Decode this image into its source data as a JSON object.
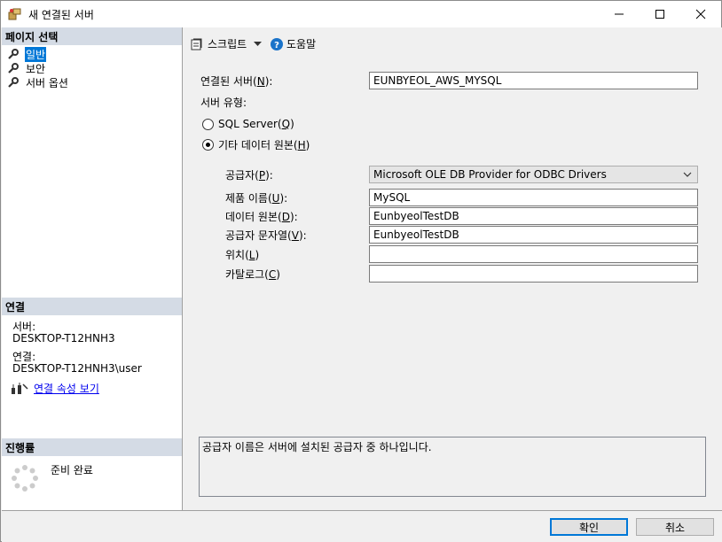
{
  "window": {
    "title": "새 연결된 서버",
    "minimize_glyph": "—",
    "maximize_glyph": "☐",
    "close_glyph": "✕"
  },
  "sidebar": {
    "page_select_header": "페이지 선택",
    "pages": [
      {
        "label": "일반",
        "selected": true
      },
      {
        "label": "보안",
        "selected": false
      },
      {
        "label": "서버 옵션",
        "selected": false
      }
    ],
    "connection_header": "연결",
    "server_label": "서버:",
    "server_value": "DESKTOP-T12HNH3",
    "connection_label": "연결:",
    "connection_value": "DESKTOP-T12HNH3\\user",
    "view_conn_props_link": "연결 속성 보기",
    "progress_header": "진행률",
    "progress_status": "준비 완료"
  },
  "toolbar": {
    "script_label": "스크립트",
    "help_label": "도움말"
  },
  "form": {
    "linked_server_label": "연결된 서버(",
    "linked_server_hotkey": "N",
    "linked_server_suffix": "):",
    "linked_server_value": "EUNBYEOL_AWS_MYSQL",
    "server_type_label": "서버 유형:",
    "sql_server_radio": "SQL Server(",
    "sql_server_hotkey": "Q",
    "sql_server_suffix": ")",
    "other_source_radio": "기타 데이터 원본(",
    "other_source_hotkey": "H",
    "other_source_suffix": ")",
    "provider_label": "공급자(",
    "provider_hotkey": "P",
    "provider_suffix": "):",
    "provider_value": "Microsoft OLE DB Provider for ODBC Drivers",
    "product_name_label": "제품 이름(",
    "product_name_hotkey": "U",
    "product_name_suffix": "):",
    "product_name_value": "MySQL",
    "data_source_label": "데이터 원본(",
    "data_source_hotkey": "D",
    "data_source_suffix": "):",
    "data_source_value": "EunbyeolTestDB",
    "provider_string_label": "공급자 문자열(",
    "provider_string_hotkey": "V",
    "provider_string_suffix": "):",
    "provider_string_value": "EunbyeolTestDB",
    "location_label": "위치(",
    "location_hotkey": "L",
    "location_suffix": ")",
    "location_value": "",
    "catalog_label": "카탈로그(",
    "catalog_hotkey": "C",
    "catalog_suffix": ")",
    "catalog_value": "",
    "description": "공급자 이름은 서버에 설치된 공급자 중 하나입니다."
  },
  "footer": {
    "ok_label": "확인",
    "cancel_label": "취소"
  },
  "colors": {
    "header_bg": "#d4dbe5",
    "selection": "#0078d7",
    "link": "#0000ee"
  }
}
